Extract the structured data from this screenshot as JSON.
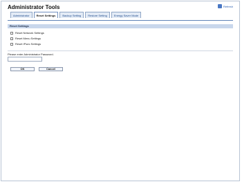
{
  "header": {
    "title": "Administrator Tools",
    "refresh_label": "Refresh"
  },
  "tabs": [
    {
      "label": "Administrator",
      "active": false
    },
    {
      "label": "Reset Settings",
      "active": true
    },
    {
      "label": "Backup Setting",
      "active": false
    },
    {
      "label": "Restore Setting",
      "active": false
    },
    {
      "label": "Energy Saver Mode",
      "active": false
    }
  ],
  "section": {
    "title": "Reset Settings",
    "options": [
      {
        "label": "Reset Network Settings",
        "checked": false
      },
      {
        "label": "Reset Menu Settings",
        "checked": false
      },
      {
        "label": "Reset IPsec Settings",
        "checked": false
      }
    ]
  },
  "password": {
    "label": "Please enter Administrator Password.",
    "value": "",
    "placeholder": ""
  },
  "buttons": {
    "ok": "OK",
    "cancel": "Cancel"
  },
  "colors": {
    "accent": "#5f82b6",
    "tab_bg": "#e3ebf6",
    "section_bg": "#c9d7ec"
  },
  "icons": {
    "refresh": "refresh-icon"
  }
}
